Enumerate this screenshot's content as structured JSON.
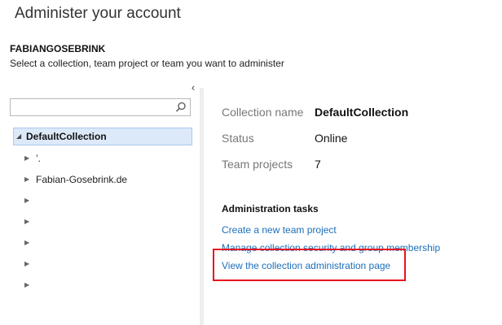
{
  "header": {
    "title": "Administer your account",
    "account_name": "FABIANGOSEBRINK",
    "instructions": "Select a collection, team project or team you want to administer"
  },
  "search": {
    "value": "",
    "placeholder": ""
  },
  "tree": {
    "root": {
      "label": "DefaultCollection"
    },
    "children": [
      {
        "label": "’."
      },
      {
        "label": "Fabian-Gosebrink.de"
      },
      {
        "label": ""
      },
      {
        "label": ""
      },
      {
        "label": ""
      },
      {
        "label": ""
      },
      {
        "label": ""
      }
    ]
  },
  "properties": [
    {
      "label": "Collection name",
      "value": "DefaultCollection"
    },
    {
      "label": "Status",
      "value": "Online"
    },
    {
      "label": "Team projects",
      "value": "7"
    }
  ],
  "admin_tasks": {
    "heading": "Administration tasks",
    "links": [
      "Create a new team project",
      "Manage collection security and group membership",
      "View the collection administration page"
    ]
  },
  "colors": {
    "link": "#1c6fb9",
    "selection_bg": "#dce9f9",
    "highlight": "#e8121f"
  },
  "icons": {
    "collapse": "chevron-left-icon",
    "search": "search-icon",
    "expanded": "triangle-expanded-icon",
    "collapsed": "triangle-collapsed-icon"
  }
}
